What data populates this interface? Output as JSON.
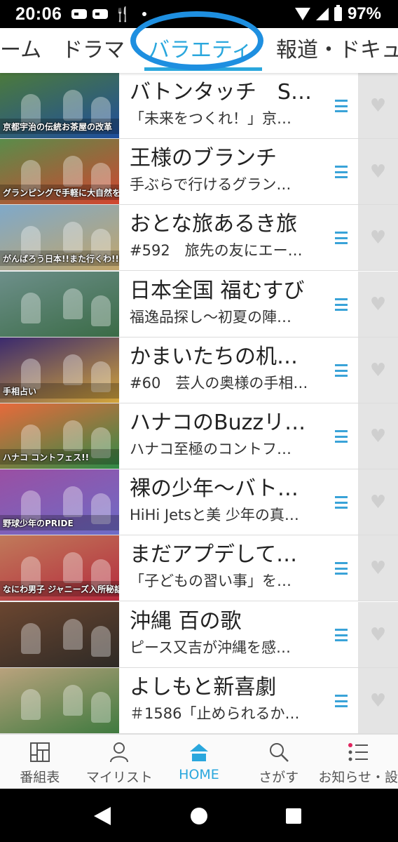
{
  "status_bar": {
    "time": "20:06",
    "battery": "97%"
  },
  "tabs": [
    {
      "label": "ーム",
      "active": false
    },
    {
      "label": "ドラマ",
      "active": false
    },
    {
      "label": "バラエティ",
      "active": true
    },
    {
      "label": "報道・ドキュ",
      "active": false
    }
  ],
  "colors": {
    "accent": "#2aa7dd",
    "highlight_circle": "#1e8fe0",
    "heart_panel": "#e4e4e4"
  },
  "programs": [
    {
      "title": "バトンタッチ　S…",
      "subtitle": "「未来をつくれ！」京…",
      "thumb_caption": "京都宇治の伝統お茶屋の改革",
      "thumb_colors": [
        "#4c7a3c",
        "#1e4e9c"
      ]
    },
    {
      "title": "王様のブランチ",
      "subtitle": "手ぶらで行けるグラン…",
      "thumb_caption": "グランピングで手軽に大自然を満喫!!",
      "thumb_colors": [
        "#5a8c4a",
        "#d2452f"
      ]
    },
    {
      "title": "おとな旅あるき旅",
      "subtitle": "#592　旅先の友にエー…",
      "thumb_caption": "がんばろう日本!!また行くわ!!SP!!",
      "thumb_colors": [
        "#7fa9c9",
        "#c2a56a"
      ]
    },
    {
      "title": "日本全国 福むすび",
      "subtitle": "福逸品探し～初夏の陣…",
      "thumb_caption": "",
      "thumb_colors": [
        "#6d8f8a",
        "#3a6b46"
      ]
    },
    {
      "title": "かまいたちの机…",
      "subtitle": "#60　芸人の奥様の手相…",
      "thumb_caption": "手相占い",
      "thumb_colors": [
        "#3b2a6e",
        "#d4a53a"
      ]
    },
    {
      "title": "ハナコのBuzzリ…",
      "subtitle": "ハナコ至極のコントフ…",
      "thumb_caption": "ハナコ コントフェス!!",
      "thumb_colors": [
        "#e76a3b",
        "#2f8a47"
      ]
    },
    {
      "title": "裸の少年～バト…",
      "subtitle": "HiHi Jetsと美 少年の真…",
      "thumb_caption": "野球少年のPRIDE",
      "thumb_colors": [
        "#9a4fa3",
        "#6d6cc7"
      ]
    },
    {
      "title": "まだアプデして…",
      "subtitle": "「子どもの習い事」を…",
      "thumb_caption": "なにわ男子 ジャニーズ入所秘話",
      "thumb_colors": [
        "#c07a5a",
        "#b52a3d"
      ]
    },
    {
      "title": "沖縄 百の歌",
      "subtitle": "ピース又吉が沖縄を感…",
      "thumb_caption": "",
      "thumb_colors": [
        "#6b4630",
        "#2e2a26"
      ]
    },
    {
      "title": "よしもと新喜劇",
      "subtitle": "＃1586「止められるか…",
      "thumb_caption": "",
      "thumb_colors": [
        "#b9a27d",
        "#3f7a3f"
      ]
    }
  ],
  "bottom_nav": [
    {
      "label": "番組表",
      "icon": "grid-icon",
      "active": false
    },
    {
      "label": "マイリスト",
      "icon": "person-icon",
      "active": false
    },
    {
      "label": "HOME",
      "icon": "home-icon",
      "active": true
    },
    {
      "label": "さがす",
      "icon": "search-icon",
      "active": false
    },
    {
      "label": "お知らせ・設",
      "icon": "notice-list-icon",
      "active": false
    }
  ]
}
